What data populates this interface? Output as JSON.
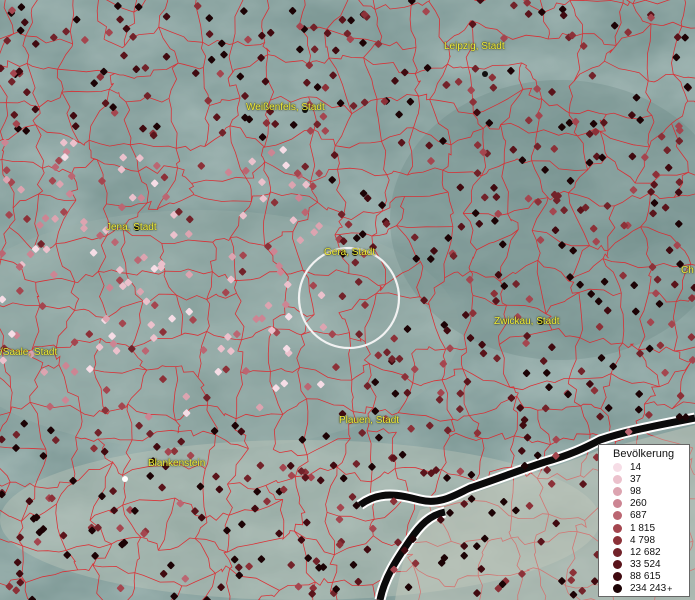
{
  "map": {
    "city_labels": [
      {
        "id": "leipzig",
        "text": "Leipzig, Stadt"
      },
      {
        "id": "weissenfels",
        "text": "Weißenfels, Stadt"
      },
      {
        "id": "jena",
        "text": "Jena, Stadt"
      },
      {
        "id": "gera",
        "text": "Gera, Stadt"
      },
      {
        "id": "zwickau",
        "text": "Zwickau, Stadt"
      },
      {
        "id": "saale",
        "text": "/Saale, Stadt"
      },
      {
        "id": "plauen",
        "text": "Plauen, Stadt"
      },
      {
        "id": "blankenstein",
        "text": "Blankenstein"
      },
      {
        "id": "ch",
        "text": "Ch"
      }
    ],
    "colors": {
      "boundary": "#e0242a",
      "terrain": "#7f9a97",
      "label": "#f2ee3a",
      "highlight_circle": "#f2f2f2"
    }
  },
  "legend": {
    "title": "Bevölkerung",
    "items": [
      {
        "label": "14",
        "color": "#f6dde6"
      },
      {
        "label": "37",
        "color": "#ebc1cc"
      },
      {
        "label": "98",
        "color": "#dca4b0"
      },
      {
        "label": "260",
        "color": "#cc8593"
      },
      {
        "label": "687",
        "color": "#bb6672"
      },
      {
        "label": "1 815",
        "color": "#a4464f"
      },
      {
        "label": "4 798",
        "color": "#8c3138"
      },
      {
        "label": "12 682",
        "color": "#72232a"
      },
      {
        "label": "33 524",
        "color": "#5a141b"
      },
      {
        "label": "88 615",
        "color": "#400a10"
      },
      {
        "label": "234 243",
        "color": "#1c0305",
        "plus": "+"
      }
    ]
  }
}
